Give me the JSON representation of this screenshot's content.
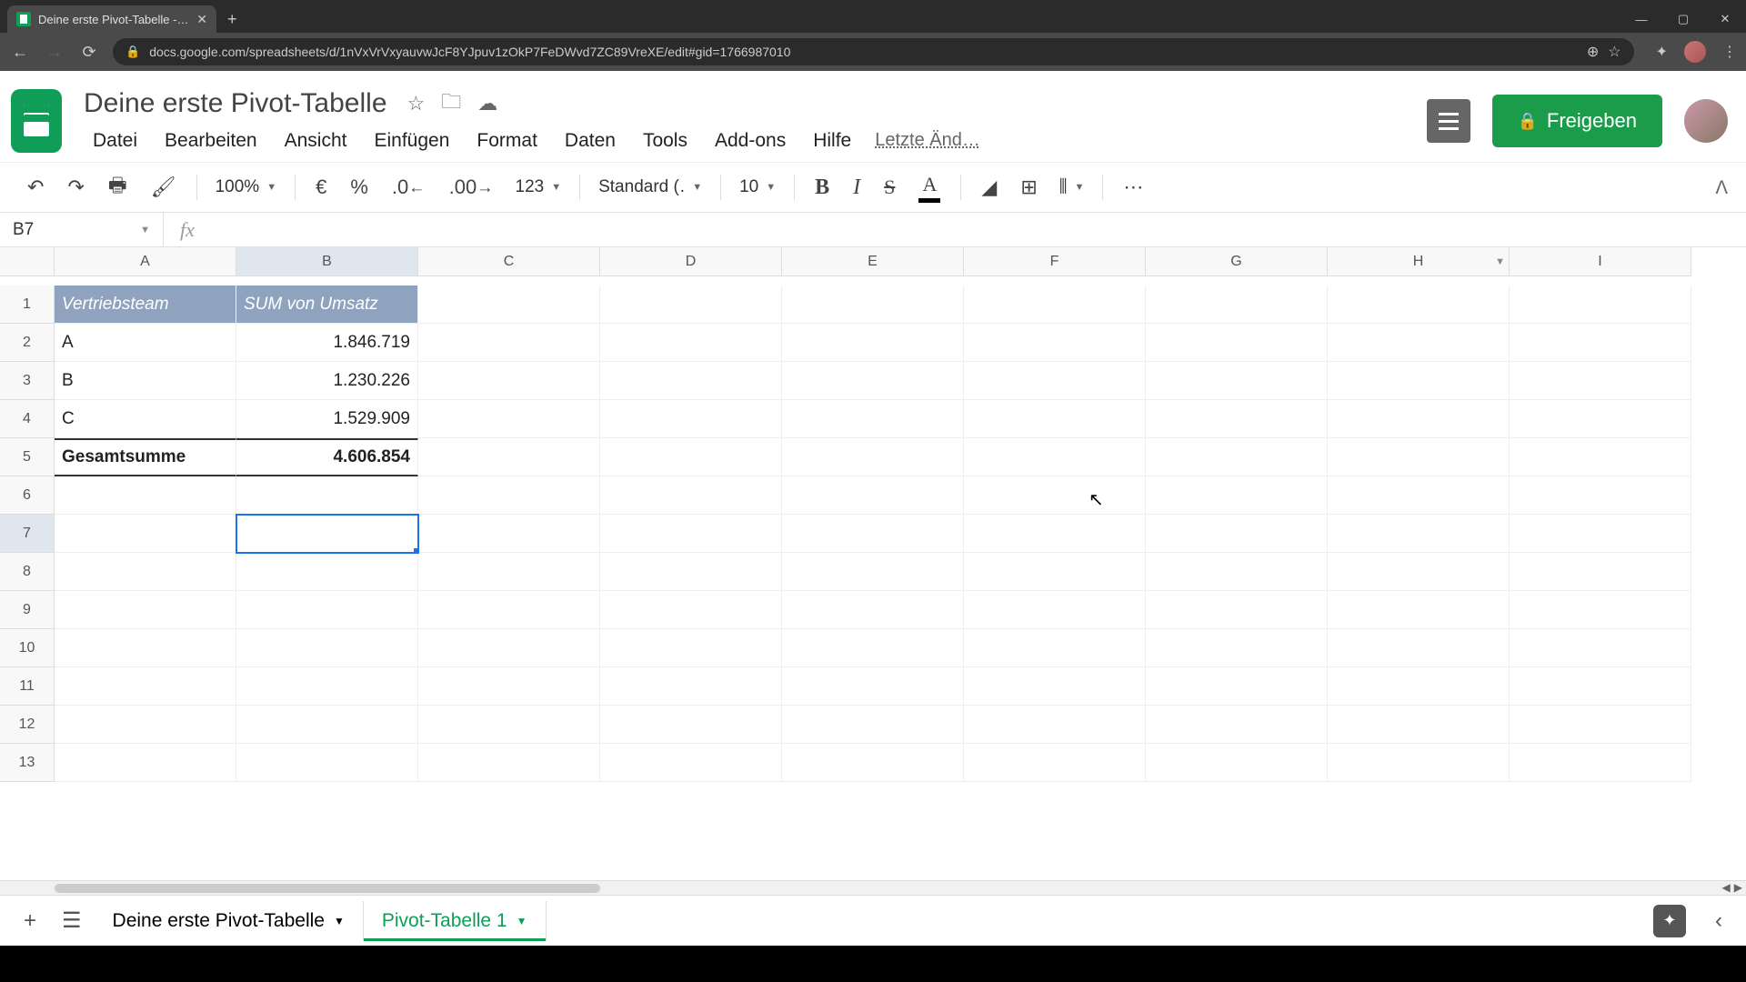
{
  "browser": {
    "tab_title": "Deine erste Pivot-Tabelle - Goog",
    "url": "docs.google.com/spreadsheets/d/1nVxVrVxyauvwJcF8YJpuv1zOkP7FeDWvd7ZC89VreXE/edit#gid=1766987010"
  },
  "doc": {
    "title": "Deine erste Pivot-Tabelle",
    "share_label": "Freigeben",
    "last_edit": "Letzte Änd…"
  },
  "menus": {
    "file": "Datei",
    "edit": "Bearbeiten",
    "view": "Ansicht",
    "insert": "Einfügen",
    "format": "Format",
    "data": "Daten",
    "tools": "Tools",
    "addons": "Add-ons",
    "help": "Hilfe"
  },
  "toolbar": {
    "zoom": "100%",
    "currency": "€",
    "percent": "%",
    "dec_less": ".0",
    "dec_more": ".00",
    "num_format": "123",
    "font": "Standard (…",
    "font_size": "10"
  },
  "fx": {
    "name_box": "B7",
    "formula": ""
  },
  "columns": [
    "A",
    "B",
    "C",
    "D",
    "E",
    "F",
    "G",
    "H",
    "I"
  ],
  "active_col_idx": 1,
  "rows": [
    1,
    2,
    3,
    4,
    5,
    6,
    7,
    8,
    9,
    10,
    11,
    12,
    13
  ],
  "active_row_idx": 6,
  "pivot": {
    "header_a": "Vertriebsteam",
    "header_b": "SUM von Umsatz",
    "rows": [
      {
        "team": "A",
        "value": "1.846.719"
      },
      {
        "team": "B",
        "value": "1.230.226"
      },
      {
        "team": "C",
        "value": "1.529.909"
      }
    ],
    "total_label": "Gesamtsumme",
    "total_value": "4.606.854"
  },
  "sheets": {
    "tab1": "Deine erste Pivot-Tabelle",
    "tab2": "Pivot-Tabelle 1"
  }
}
